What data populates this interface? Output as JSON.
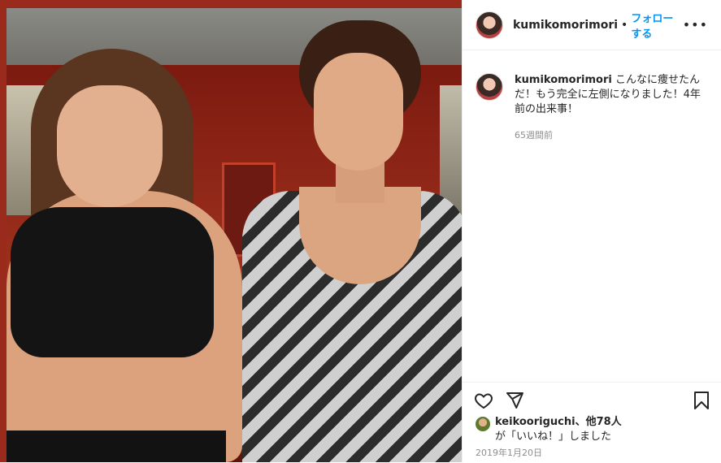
{
  "post": {
    "username": "kumikomorimori",
    "separator": "•",
    "follow_label": "フォローする",
    "more_label": "•••"
  },
  "caption": {
    "username": "kumikomorimori",
    "text": "こんなに痩せたんだ！もう完全に左側になりました！4年前の出来事！",
    "time": "65週間前"
  },
  "likes": {
    "user": "keikooriguchi",
    "others": "、他78人",
    "suffix": "が「いいね！」しました"
  },
  "date": "2019年1月20日",
  "icons": {
    "like": "heart-icon",
    "share": "send-icon",
    "save": "bookmark-icon",
    "more": "more-icon"
  },
  "colors": {
    "accent": "#0095f6",
    "muted": "#8e8e8e",
    "text": "#262626"
  }
}
